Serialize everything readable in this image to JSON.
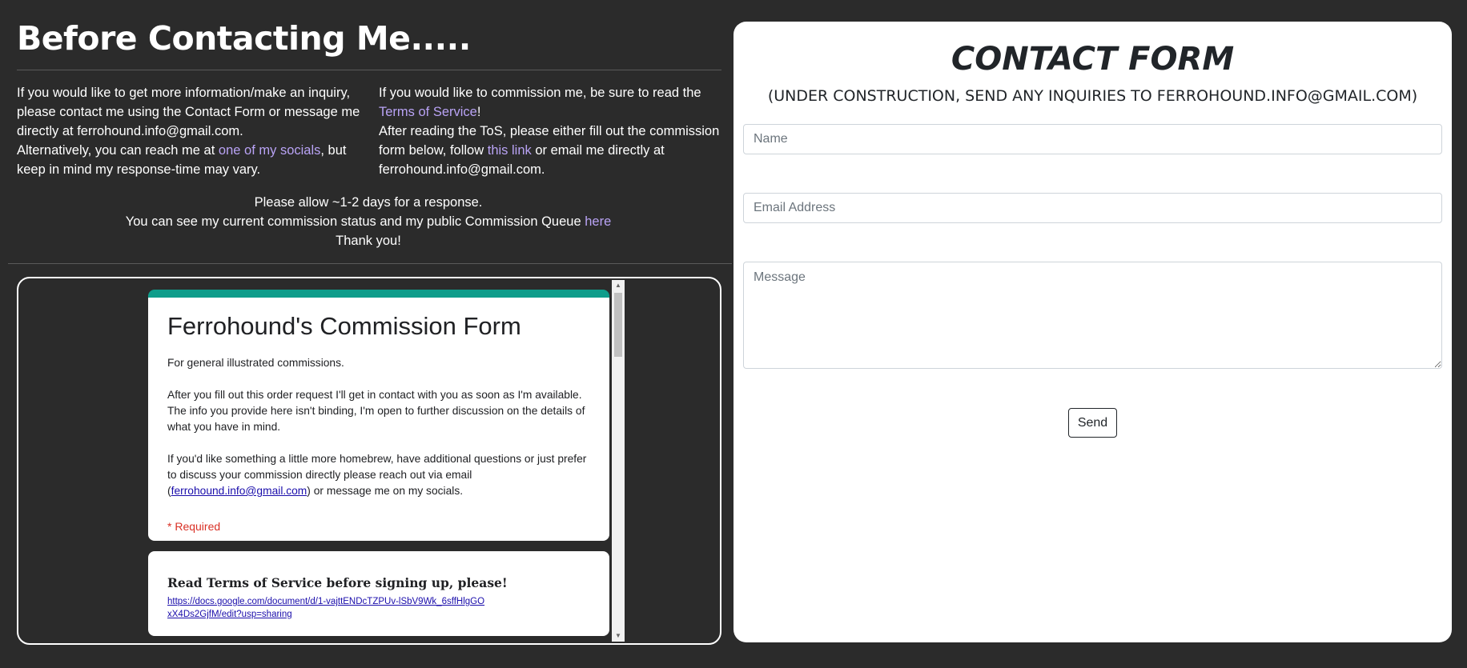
{
  "left": {
    "title": "Before Contacting Me.....",
    "col1": {
      "p1": "If you would like to get more information/make an inquiry, please contact me using the Contact Form or message me directly at ferrohound.info@gmail.com.",
      "p2_before": "Alternatively, you can reach me at ",
      "p2_link": "one of my socials",
      "p2_after": ", but keep in mind my response-time may vary."
    },
    "col2": {
      "p1_before": "If you would like to commission me, be sure to read the ",
      "p1_link": "Terms of Service",
      "p1_after": "!",
      "p2_before": "After reading the ToS, please either fill out the commission form below, follow ",
      "p2_link": "this link",
      "p2_after": " or email me directly at ferrohound.info@gmail.com."
    },
    "center": {
      "line1": "Please allow ~1-2 days for a response.",
      "line2_before": "You can see my current commission status and my public Commission Queue ",
      "line2_link": "here",
      "line3": "Thank you!"
    }
  },
  "embed": {
    "form_title": "Ferrohound's Commission Form",
    "desc1": "For general illustrated commissions.",
    "desc2": "After you fill out this order request I'll get in contact with you as soon as I'm available. The info you provide here isn't binding, I'm open to further discussion on the details of what you have in mind.",
    "desc3_before": "If you'd like something a little more homebrew, have additional questions or just prefer to discuss your commission directly please reach out via email (",
    "desc3_link": "ferrohound.info@gmail.com",
    "desc3_after": ") or message me on my socials.",
    "required": "* Required",
    "tos_title": "Read Terms of Service before signing up, please!",
    "tos_link": "https://docs.google.com/document/d/1-vajttENDcTZPUv-lSbV9Wk_6sffHlgGOxX4Ds2GjfM/edit?usp=sharing"
  },
  "contact": {
    "title": "CONTACT FORM",
    "subtitle": "(UNDER CONSTRUCTION, SEND ANY INQUIRIES TO FERROHOUND.INFO@GMAIL.COM)",
    "name_placeholder": "Name",
    "email_placeholder": "Email Address",
    "message_placeholder": "Message",
    "send_label": "Send"
  },
  "colors": {
    "background": "#2b2b2b",
    "link": "#b9a3f5",
    "form_accent": "#0f9d8b",
    "required": "#d93025"
  }
}
